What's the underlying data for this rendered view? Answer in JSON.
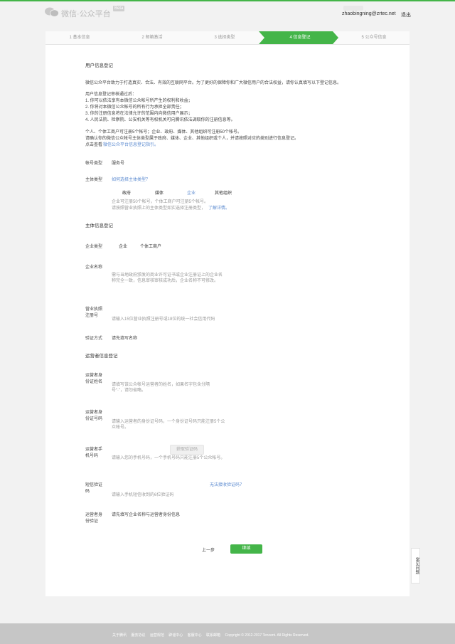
{
  "header": {
    "brand": "微信·公众平台",
    "beta": "Beta",
    "email": "zhaobingning@zrtec.net",
    "logout": "退出"
  },
  "steps": [
    "1 基本信息",
    "2 邮箱激活",
    "3 选择类型",
    "4 信息登记",
    "5 公众号信息"
  ],
  "intro": {
    "title": "用户信息登记",
    "p1": "微信公众平台致力于打造真实、合法、有效的互联网平台。为了更好的保障你和广大微信用户的合法权益，请你认真填写以下登记信息。",
    "p2_title": "用户信息登记审核通过后：",
    "p2_items": [
      "1. 你可以依法享有本微信公众帐号所产生的权利和收益；",
      "2. 你将对本微信公众帐号的所有行为承担全部责任；",
      "3. 你的注册信息将在法律允许的范围内向微信用户展示；",
      "4. 人民法院、检察院、公安机关等有权机关可向腾讯依法调取你的注册信息等。"
    ],
    "p3a": "个人、个体工商户可注册5个帐号；企业、政府、媒体、其他组织可注册50个帐号。",
    "p3b": "请确认你的微信公众帐号主体类型属于政府、媒体、企业、其他组织或个人，并请按照对应的类别进行信息登记。",
    "p3c_prefix": "点击查看",
    "p3c_link": "微信公众平台信息登记指引。"
  },
  "account_type": {
    "label": "帐号类型",
    "value": "服务号"
  },
  "subject_type": {
    "label": "主体类型",
    "help_link": "如何选择主体类型？",
    "options": [
      "政府",
      "媒体",
      "企业",
      "其他组织"
    ],
    "selected": "企业",
    "note1": "企业可注册50个帐号，个体工商户可注册5个帐号。",
    "note2_prefix": "请按照营业执照上的主体类型如实选择注册类型，",
    "note2_link": "了解详情。"
  },
  "subject_section": "主体信息登记",
  "enterprise_type": {
    "label": "企业类型",
    "options": [
      "企业",
      "个体工商户"
    ]
  },
  "company_name": {
    "label": "企业名称",
    "hint": "需与当地政府颁发的商业许可证书或企业注册证上的企业名称完全一致，信息审核审核成功后，企业名称不可修改。"
  },
  "license_no": {
    "label1": "营业执照",
    "label2": "注册号",
    "placeholder": "请输入15位营业执照注册号或18位的统一社会信用代码"
  },
  "verify_method": {
    "label": "验证方式",
    "value": "请先填写名称"
  },
  "operator_section": "运营者信息登记",
  "operator_name": {
    "label1": "运营者身",
    "label2": "份证姓名",
    "hint": "请填写该公众帐号运营者的姓名，如果名字包含分隔号“·”，请勿省略。"
  },
  "operator_id": {
    "label1": "运营者身",
    "label2": "份证号码",
    "hint": "请输入运营者的身份证号码，一个身份证号码只能注册5个公众帐号。"
  },
  "operator_phone": {
    "label1": "运营者手",
    "label2": "机号码",
    "button": "获取验证码",
    "hint": "请输入您的手机号码，一个手机号码只能注册5个公众帐号。"
  },
  "sms_code": {
    "label1": "短信验证",
    "label2": "码",
    "link": "无法接收验证码？",
    "hint": "请输入手机短信收到的6位验证码"
  },
  "operator_verify": {
    "label1": "运营者身",
    "label2": "份验证",
    "value": "请先填写企业名称与运营者身份信息"
  },
  "actions": {
    "prev": "上一步",
    "next": "继续"
  },
  "faq": "常见问题",
  "footer": {
    "links": [
      "关于腾讯",
      "服务协议",
      "运营规范",
      "辟谣中心",
      "客服中心",
      "联系邮箱"
    ],
    "copyright": "Copyright © 2012-2017 Tencent. All Rights Reserved."
  },
  "colors": {
    "accent": "#44b549",
    "link": "#5b8ad0"
  }
}
